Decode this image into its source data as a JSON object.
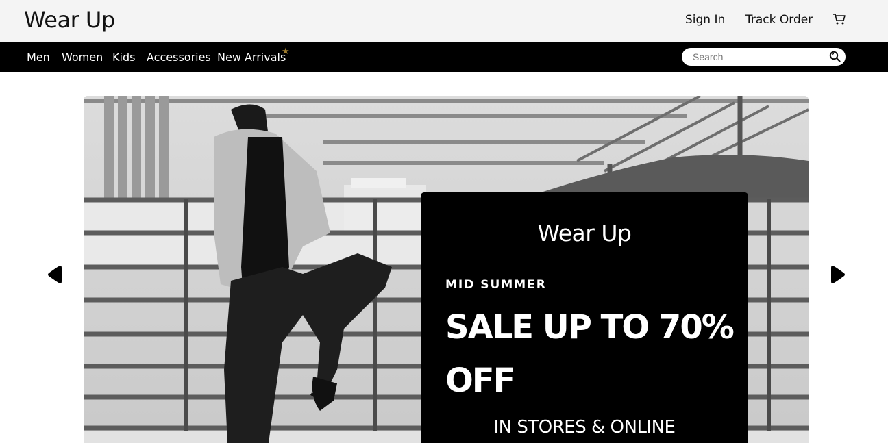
{
  "header": {
    "brand": "Wear Up",
    "sign_in": "Sign In",
    "track_order": "Track Order",
    "cart_icon": "cart-icon"
  },
  "nav": {
    "items": [
      {
        "label": "Men"
      },
      {
        "label": "Women"
      },
      {
        "label": "Kids"
      },
      {
        "label": "Accessories"
      },
      {
        "label": "New Arrivals",
        "badge_icon": "star-icon",
        "badge_color": "#a07d2e"
      }
    ],
    "search_placeholder": "Search",
    "search_icon": "search-icon"
  },
  "hero": {
    "photo": "black-and-white fashion model on rooftop",
    "promo_brand": "Wear Up",
    "promo_subtitle": "MID SUMMER",
    "promo_headline": "SALE UP TO 70% OFF",
    "promo_footer": "IN STORES & ONLINE",
    "prev_icon": "triangle-left-icon",
    "next_icon": "triangle-right-icon"
  },
  "colors": {
    "topbar_bg": "#f4f4f4",
    "navbar_bg": "#000000",
    "promo_bg": "#000000",
    "text_dark": "#111111"
  }
}
